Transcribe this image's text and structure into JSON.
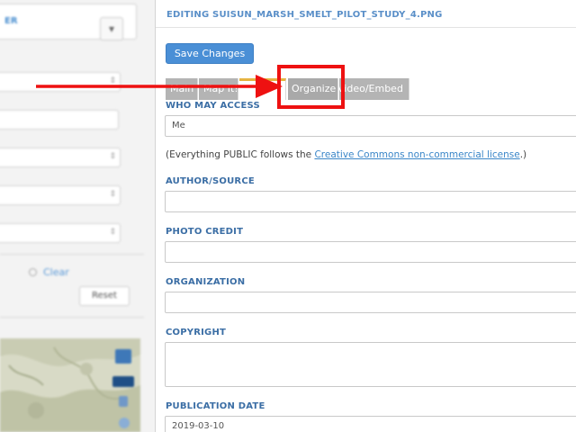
{
  "left_panel": {
    "header_text": "ER",
    "header_button_icon": "chevron-down-icon",
    "clear_label": "Clear",
    "reset_label": "Reset"
  },
  "editor": {
    "title": "EDITING SUISUN_MARSH_SMELT_PILOT_STUDY_4.PNG",
    "save_label": "Save Changes",
    "tabs": [
      {
        "label": "Main"
      },
      {
        "label": "Map It!"
      },
      {
        "label": ""
      },
      {
        "label": "Organize"
      },
      {
        "label": "Video/Embed"
      }
    ],
    "who_may_access": {
      "label": "WHO MAY ACCESS",
      "value": "Me"
    },
    "notice": {
      "before": "(Everything PUBLIC follows the ",
      "link": "Creative Commons non-commercial license",
      "after": ".)"
    },
    "fields": [
      {
        "label": "AUTHOR/SOURCE",
        "value": ""
      },
      {
        "label": "PHOTO CREDIT",
        "value": ""
      },
      {
        "label": "ORGANIZATION",
        "value": ""
      },
      {
        "label": "COPYRIGHT",
        "value": ""
      },
      {
        "label": "PUBLICATION DATE",
        "value": "2019-03-10"
      }
    ]
  },
  "annotation": {
    "arrow_color": "#ee1111",
    "box_color": "#ee1111"
  }
}
